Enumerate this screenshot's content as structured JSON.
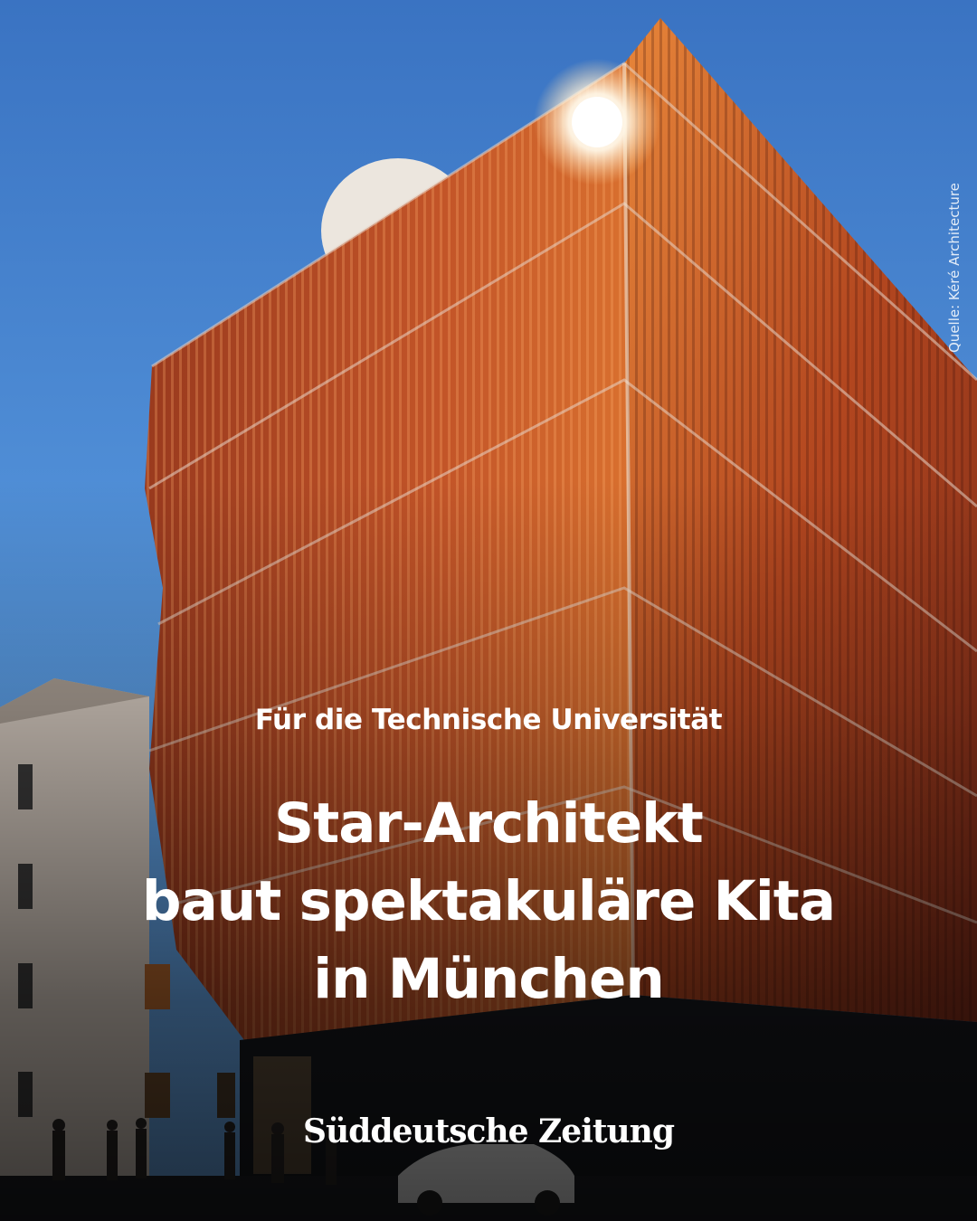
{
  "image": {
    "kind": "architectural rendering",
    "colors": {
      "sky_top": "#3f79c6",
      "sky_bottom": "#5d9de0",
      "facade": "#c0502a",
      "facade_light": "#ea8a3c",
      "facade_dark": "#7a2a18",
      "neighbor_wall": "#cfc3b8",
      "ground": "#16181d"
    }
  },
  "credit": {
    "text": "Quelle: Kéré Architecture"
  },
  "article": {
    "kicker": "Für die Technische Universität",
    "headline_lines": [
      "Star-Architekt",
      "baut spektakuläre Kita",
      "in München"
    ]
  },
  "brand": {
    "logo_text": "Süddeutsche Zeitung"
  }
}
